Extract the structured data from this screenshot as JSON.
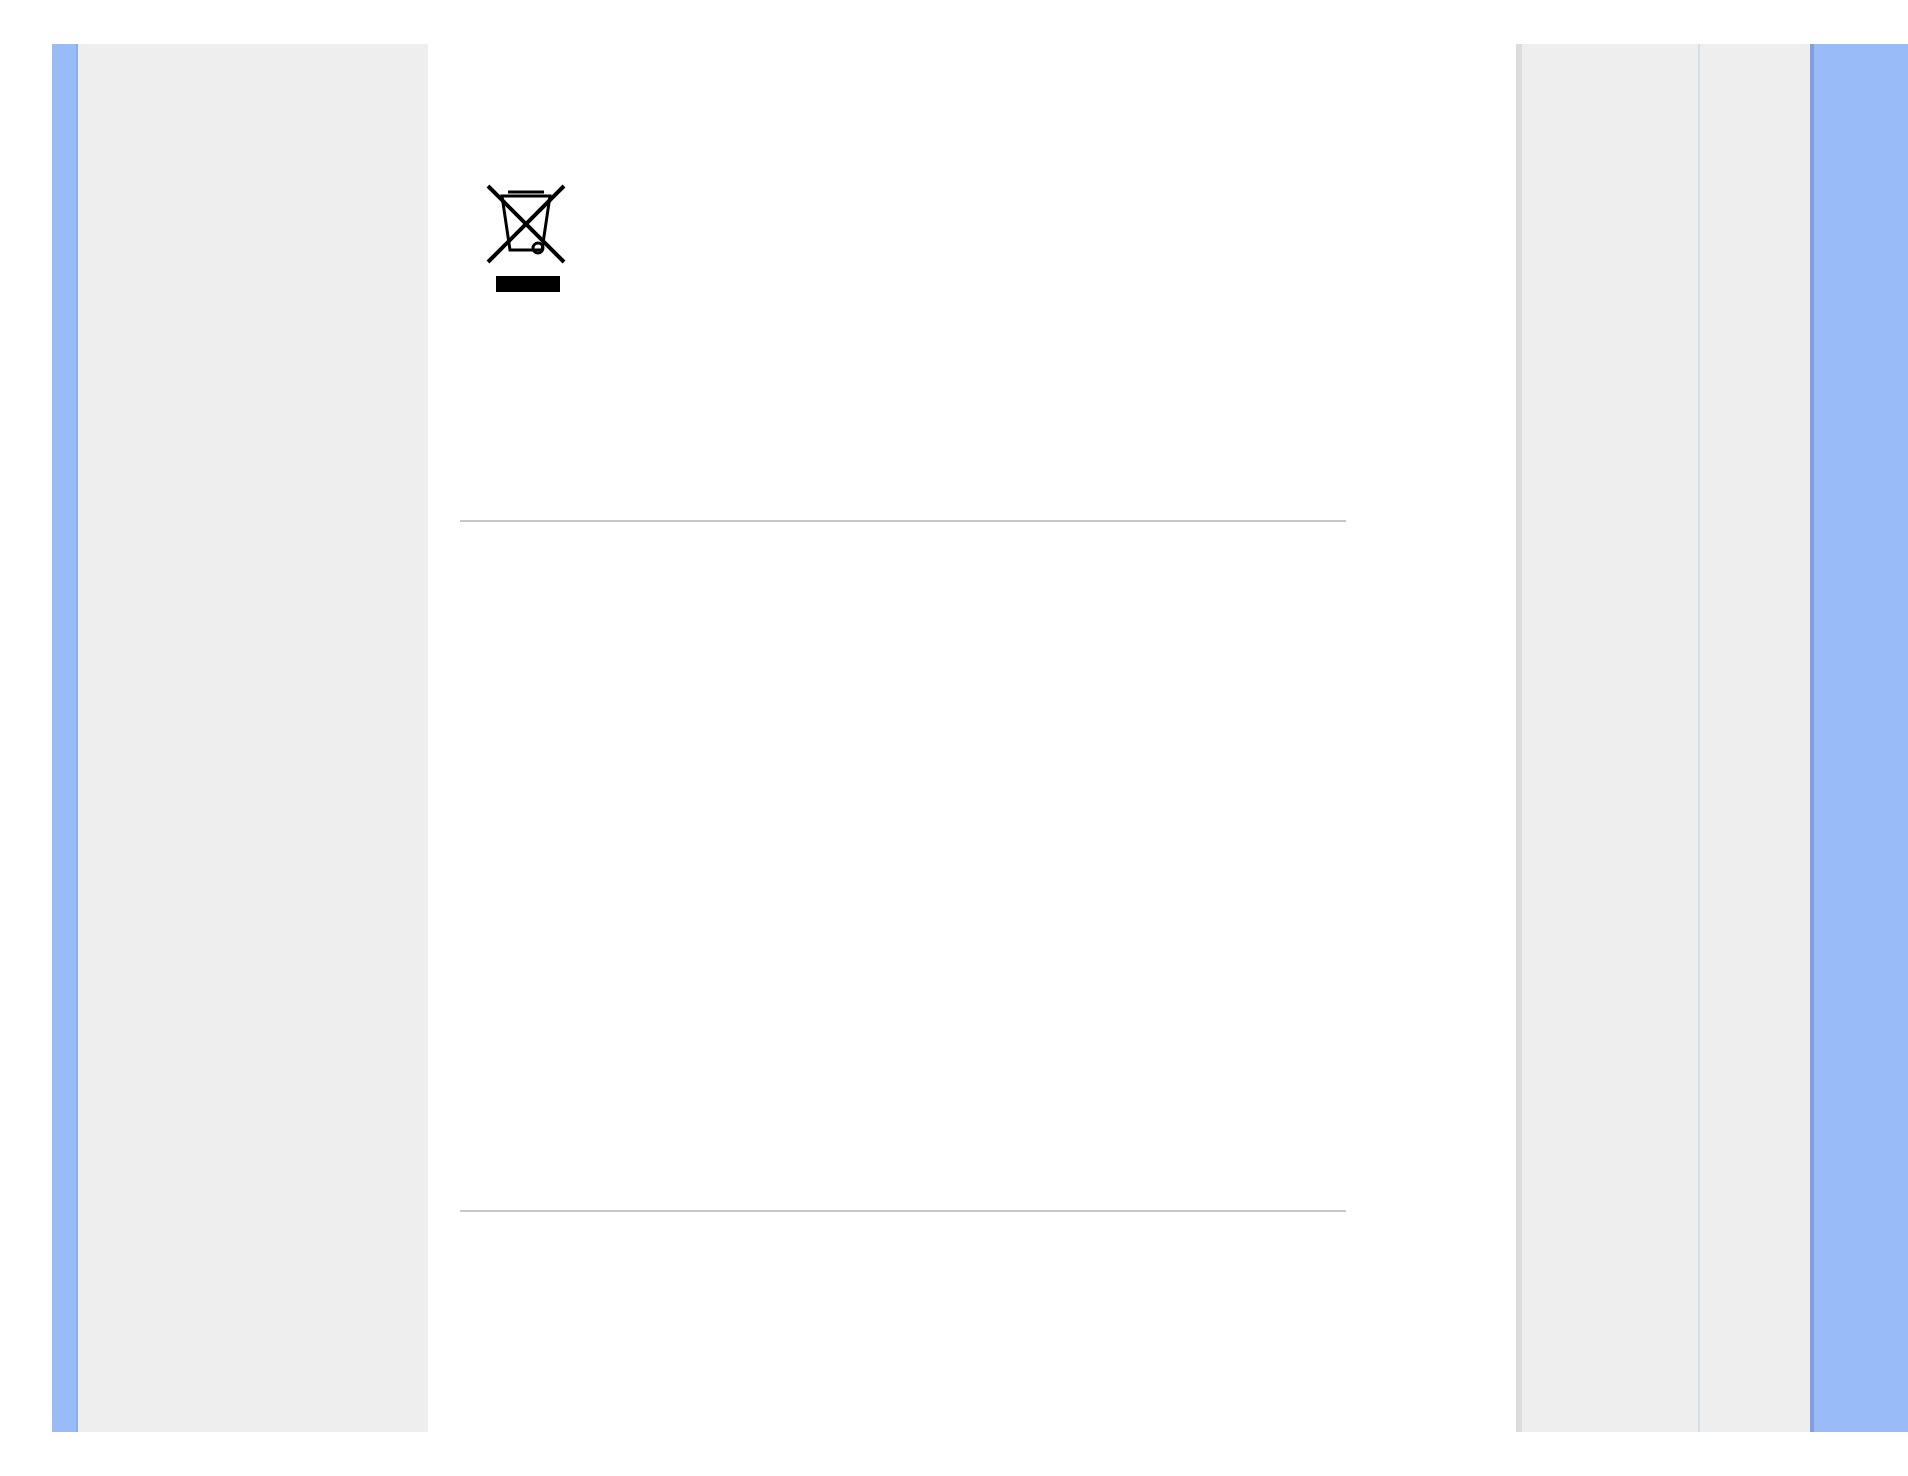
{
  "content": [
    {
      "kind": "disposal-symbol"
    },
    {
      "kind": "divider"
    },
    {
      "kind": "divider"
    }
  ]
}
